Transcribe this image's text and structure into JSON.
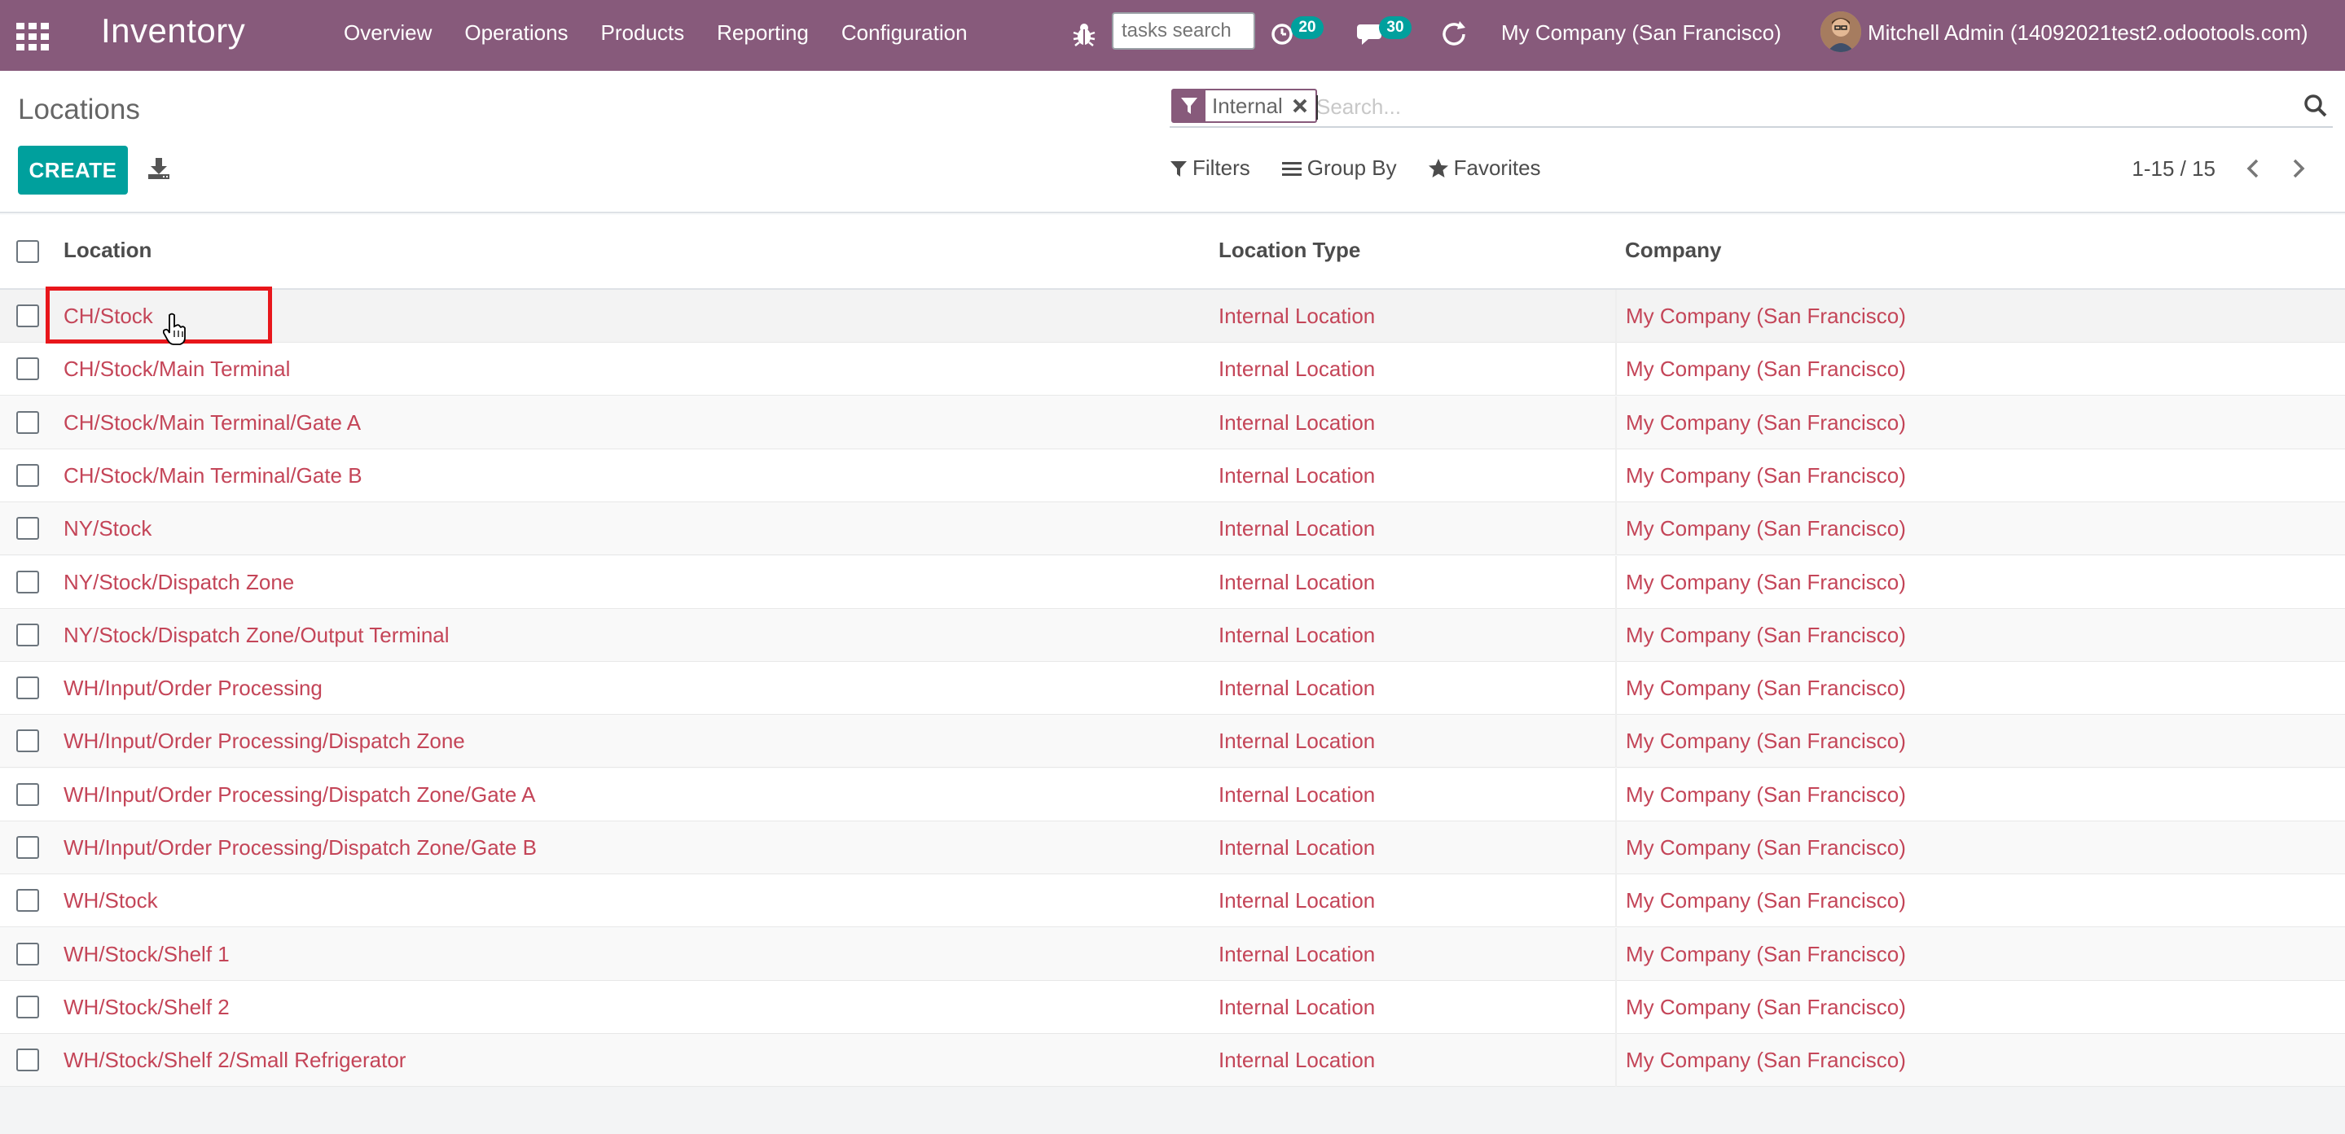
{
  "navbar": {
    "app_name": "Inventory",
    "menu": [
      "Overview",
      "Operations",
      "Products",
      "Reporting",
      "Configuration"
    ],
    "tasks_search_placeholder": "tasks search",
    "activity_count": "20",
    "messages_count": "30",
    "company": "My Company (San Francisco)",
    "user": "Mitchell Admin (14092021test2.odootools.com)",
    "brand_color": "#875a7b"
  },
  "control_panel": {
    "title": "Locations",
    "create_label": "CREATE",
    "facet_label": "Internal",
    "search_placeholder": "Search...",
    "filters_label": "Filters",
    "groupby_label": "Group By",
    "favorites_label": "Favorites",
    "pager": "1-15 / 15",
    "accent_color": "#00a09d"
  },
  "table": {
    "columns": [
      "Location",
      "Location Type",
      "Company"
    ],
    "rows": [
      [
        "CH/Stock",
        "Internal Location",
        "My Company (San Francisco)"
      ],
      [
        "CH/Stock/Main Terminal",
        "Internal Location",
        "My Company (San Francisco)"
      ],
      [
        "CH/Stock/Main Terminal/Gate A",
        "Internal Location",
        "My Company (San Francisco)"
      ],
      [
        "CH/Stock/Main Terminal/Gate B",
        "Internal Location",
        "My Company (San Francisco)"
      ],
      [
        "NY/Stock",
        "Internal Location",
        "My Company (San Francisco)"
      ],
      [
        "NY/Stock/Dispatch Zone",
        "Internal Location",
        "My Company (San Francisco)"
      ],
      [
        "NY/Stock/Dispatch Zone/Output Terminal",
        "Internal Location",
        "My Company (San Francisco)"
      ],
      [
        "WH/Input/Order Processing",
        "Internal Location",
        "My Company (San Francisco)"
      ],
      [
        "WH/Input/Order Processing/Dispatch Zone",
        "Internal Location",
        "My Company (San Francisco)"
      ],
      [
        "WH/Input/Order Processing/Dispatch Zone/Gate A",
        "Internal Location",
        "My Company (San Francisco)"
      ],
      [
        "WH/Input/Order Processing/Dispatch Zone/Gate B",
        "Internal Location",
        "My Company (San Francisco)"
      ],
      [
        "WH/Stock",
        "Internal Location",
        "My Company (San Francisco)"
      ],
      [
        "WH/Stock/Shelf 1",
        "Internal Location",
        "My Company (San Francisco)"
      ],
      [
        "WH/Stock/Shelf 2",
        "Internal Location",
        "My Company (San Francisco)"
      ],
      [
        "WH/Stock/Shelf 2/Small Refrigerator",
        "Internal Location",
        "My Company (San Francisco)"
      ]
    ],
    "link_color": "#c44558"
  }
}
